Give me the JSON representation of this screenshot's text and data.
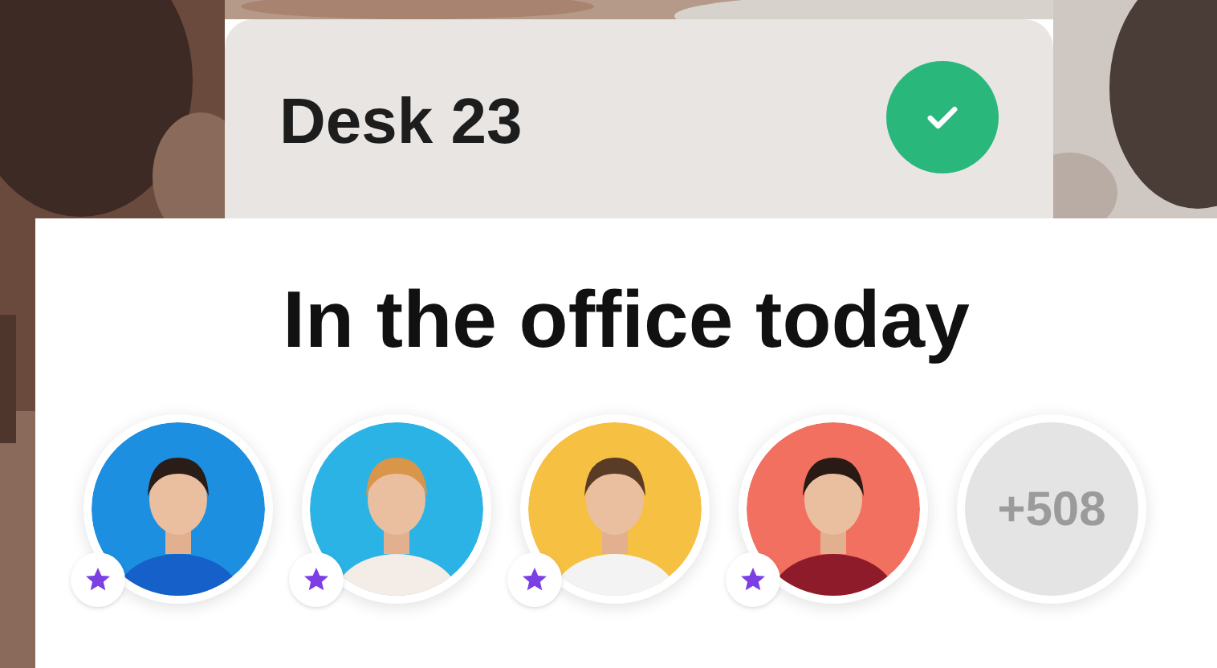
{
  "desk_card": {
    "label": "Desk 23",
    "confirmed": true
  },
  "office_card": {
    "title": "In the office today",
    "people": [
      {
        "kind": "picture",
        "starred": true
      },
      {
        "kind": "picture",
        "starred": true
      },
      {
        "kind": "picture",
        "starred": true
      },
      {
        "kind": "picture",
        "starred": true
      }
    ],
    "more_count": "+508"
  }
}
